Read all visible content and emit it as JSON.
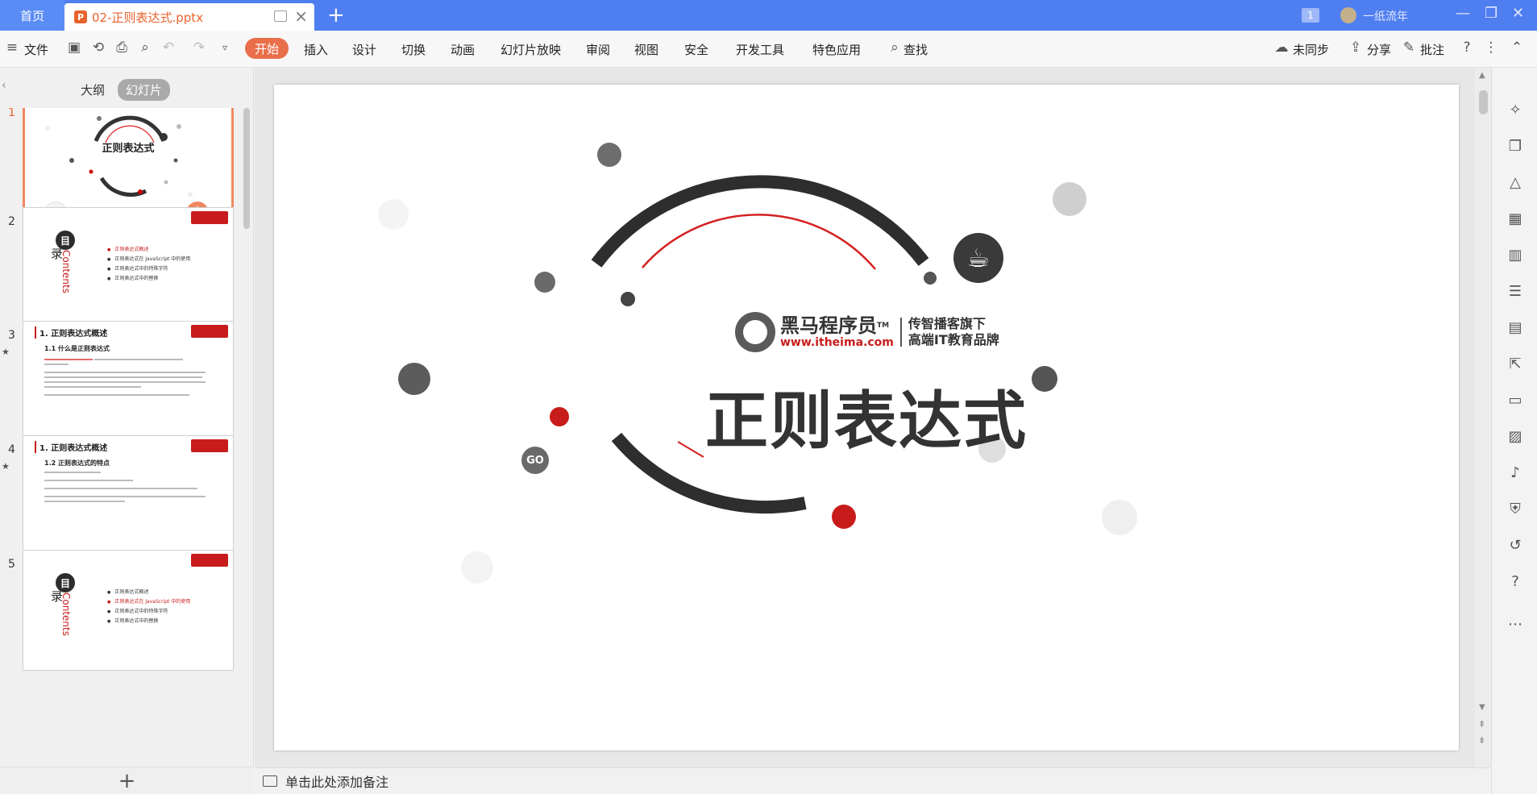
{
  "titlebar": {
    "home_tab": "首页",
    "doc_tab_title": "02-正则表达式.pptx",
    "ppt_icon": "P",
    "page_count_badge": "1",
    "user_name": "一纸流年"
  },
  "ribbon": {
    "file_menu": "文件",
    "tabs": [
      "开始",
      "插入",
      "设计",
      "切换",
      "动画",
      "幻灯片放映",
      "审阅",
      "视图",
      "安全",
      "开发工具",
      "特色应用"
    ],
    "search": "查找",
    "sync": "未同步",
    "share": "分享",
    "comment": "批注"
  },
  "left_panel": {
    "view_outline": "大纲",
    "view_slides": "幻灯片",
    "slide_numbers": [
      "1",
      "2",
      "3",
      "4",
      "5"
    ],
    "thumb1_title": "正则表达式",
    "thumb2_toc": "目",
    "thumb2_lu": "录",
    "thumb2_contents": "Contents",
    "thumb3_title": "1. 正则表达式概述",
    "thumb3_sub": "1.1 什么是正则表达式",
    "thumb4_title": "1. 正则表达式概述",
    "thumb4_sub": "1.2 正则表达式的特点",
    "toc_items": [
      "正则表达式概述",
      "正则表达式在 JavaScript 中的使用",
      "正则表达式中的特殊字符",
      "正则表达式中的替换"
    ]
  },
  "slide": {
    "title": "正则表达式",
    "brand_name": "黑马程序员",
    "brand_tm": "TM",
    "brand_url": "www.itheima.com",
    "tagline_1": "传智播客旗下",
    "tagline_2": "高端IT教育品牌",
    "icon_go_label": "GO"
  },
  "notes": {
    "placeholder": "单击此处添加备注"
  },
  "colors": {
    "accent": "#e8622c",
    "titlebar": "#4f7ef1",
    "brand_red": "#c81c1c"
  }
}
